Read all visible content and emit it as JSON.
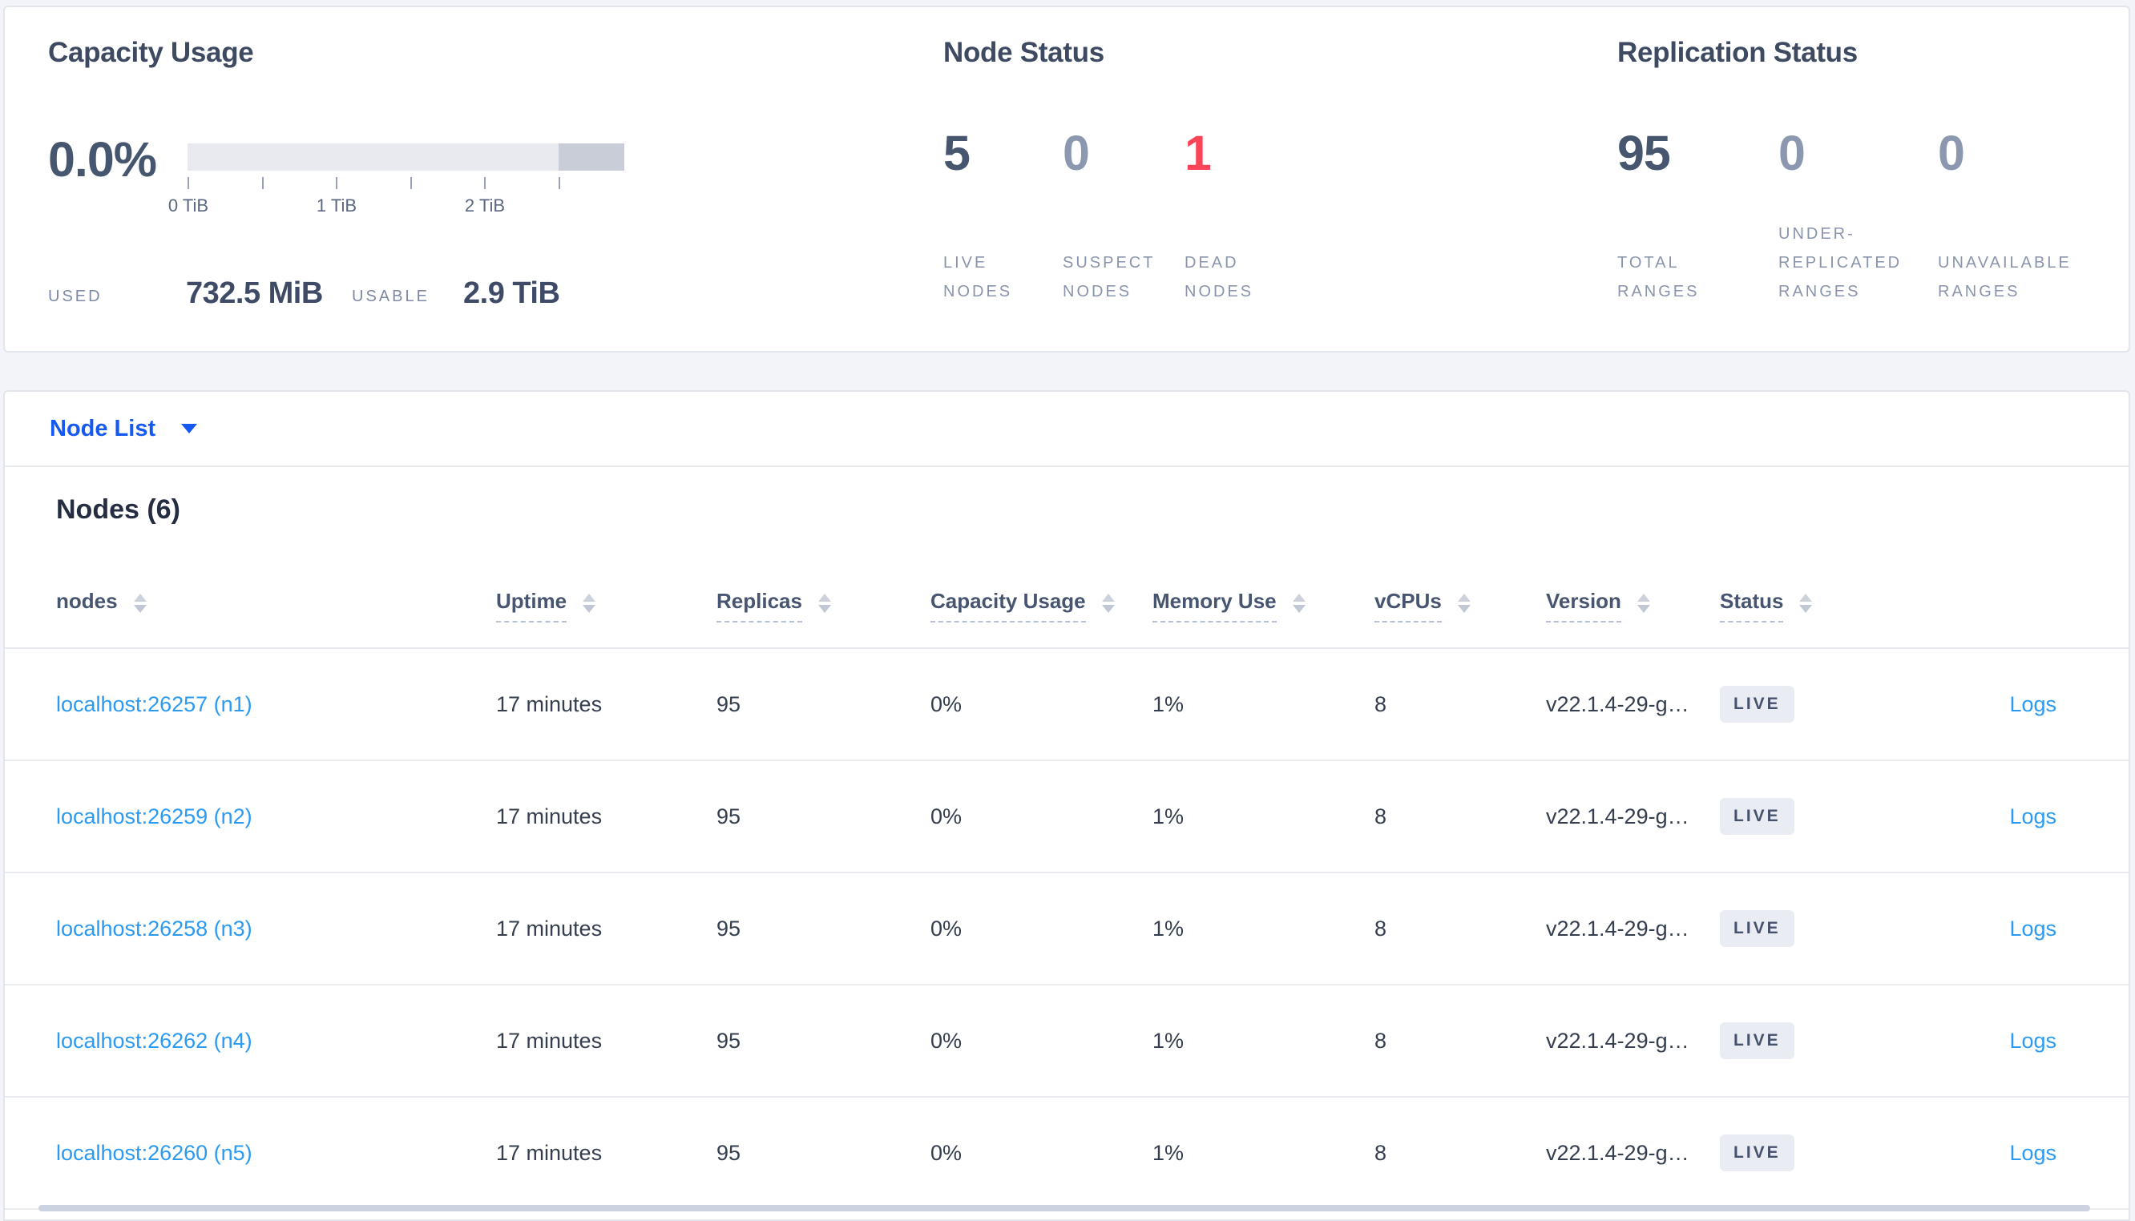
{
  "colors": {
    "accent_blue": "#1659f0",
    "link_blue": "#2a9af3",
    "danger_red": "#fb4458",
    "dark_metric": "#47566f",
    "muted_metric": "#8c97b0",
    "badge_bg": "#e9edf3"
  },
  "summary": {
    "capacity": {
      "title": "Capacity Usage",
      "percent": "0.0%",
      "tick_labels": [
        "0 TiB",
        "1 TiB",
        "2 TiB"
      ],
      "used_label": "USED",
      "used_value": "732.5 MiB",
      "usable_label": "USABLE",
      "usable_value": "2.9 TiB"
    },
    "node_status": {
      "title": "Node Status",
      "metrics": [
        {
          "value": "5",
          "label": "LIVE NODES"
        },
        {
          "value": "0",
          "label": "SUSPECT NODES"
        },
        {
          "value": "1",
          "label": "DEAD NODES"
        }
      ]
    },
    "replication": {
      "title": "Replication Status",
      "metrics": [
        {
          "value": "95",
          "label": "TOTAL RANGES"
        },
        {
          "value": "0",
          "label": "UNDER-REPLICATED RANGES"
        },
        {
          "value": "0",
          "label": "UNAVAILABLE RANGES"
        }
      ]
    }
  },
  "view_selector": {
    "label": "Node List"
  },
  "nodes_section": {
    "title": "Nodes (6)",
    "columns": [
      {
        "label": "nodes"
      },
      {
        "label": "Uptime"
      },
      {
        "label": "Replicas"
      },
      {
        "label": "Capacity Usage"
      },
      {
        "label": "Memory Use"
      },
      {
        "label": "vCPUs"
      },
      {
        "label": "Version"
      },
      {
        "label": "Status"
      }
    ],
    "rows": [
      {
        "address": "localhost:26257 (n1)",
        "uptime": "17 minutes",
        "replicas": "95",
        "capacity": "0%",
        "memory": "1%",
        "vcpus": "8",
        "version": "v22.1.4-29-g…",
        "status": "LIVE",
        "logs": "Logs"
      },
      {
        "address": "localhost:26259 (n2)",
        "uptime": "17 minutes",
        "replicas": "95",
        "capacity": "0%",
        "memory": "1%",
        "vcpus": "8",
        "version": "v22.1.4-29-g…",
        "status": "LIVE",
        "logs": "Logs"
      },
      {
        "address": "localhost:26258 (n3)",
        "uptime": "17 minutes",
        "replicas": "95",
        "capacity": "0%",
        "memory": "1%",
        "vcpus": "8",
        "version": "v22.1.4-29-g…",
        "status": "LIVE",
        "logs": "Logs"
      },
      {
        "address": "localhost:26262 (n4)",
        "uptime": "17 minutes",
        "replicas": "95",
        "capacity": "0%",
        "memory": "1%",
        "vcpus": "8",
        "version": "v22.1.4-29-g…",
        "status": "LIVE",
        "logs": "Logs"
      },
      {
        "address": "localhost:26260 (n5)",
        "uptime": "17 minutes",
        "replicas": "95",
        "capacity": "0%",
        "memory": "1%",
        "vcpus": "8",
        "version": "v22.1.4-29-g…",
        "status": "LIVE",
        "logs": "Logs"
      }
    ]
  }
}
